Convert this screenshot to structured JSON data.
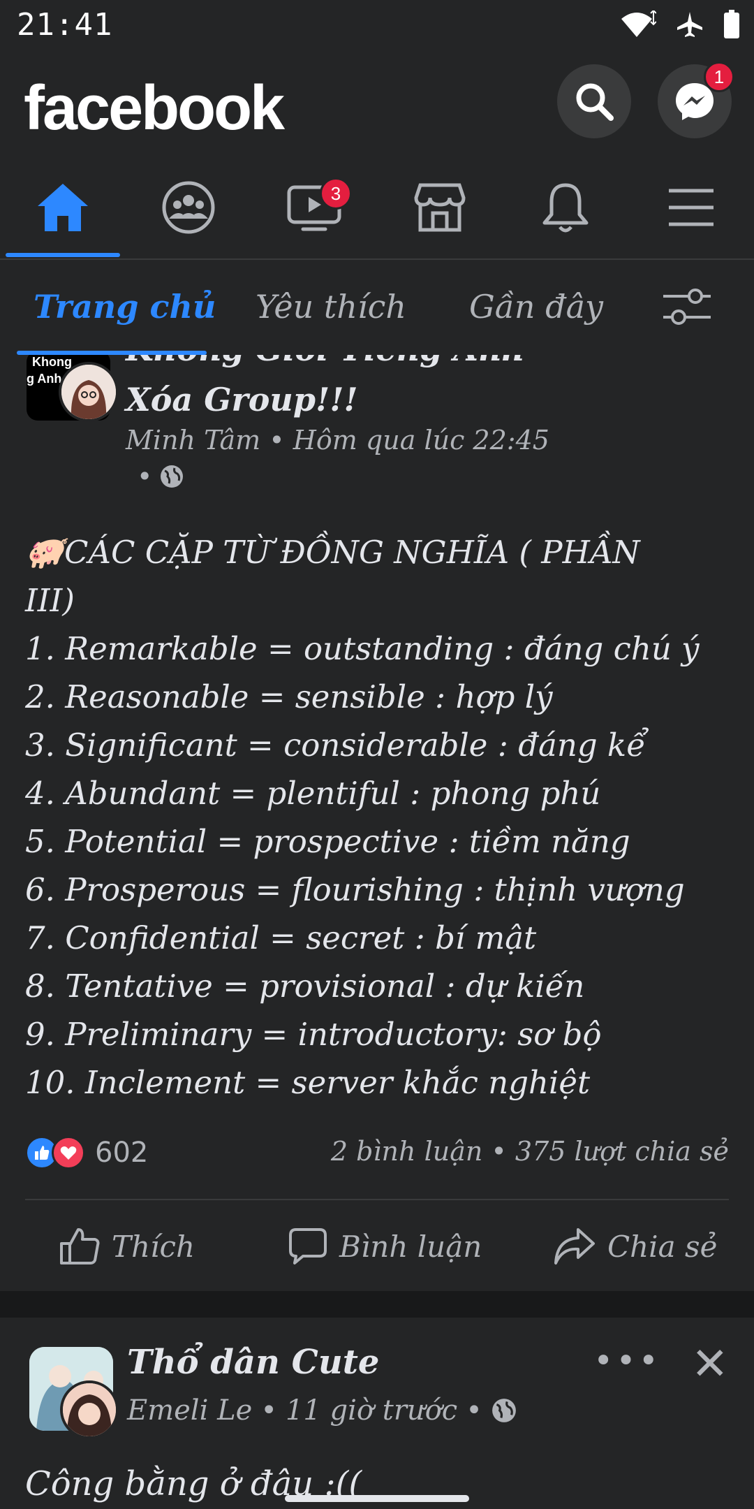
{
  "status_bar": {
    "time": "21:41"
  },
  "header": {
    "logo": "facebook",
    "messenger_badge": "1"
  },
  "nav": {
    "tabs": [
      {
        "name": "home",
        "icon": "home-icon",
        "active": true
      },
      {
        "name": "groups",
        "icon": "groups-icon"
      },
      {
        "name": "watch",
        "icon": "watch-icon",
        "badge": "3"
      },
      {
        "name": "marketplace",
        "icon": "marketplace-icon"
      },
      {
        "name": "notifications",
        "icon": "bell-icon"
      },
      {
        "name": "menu",
        "icon": "menu-icon"
      }
    ],
    "watch_badge": "3"
  },
  "feed_filter": {
    "tabs": [
      "Trang chủ",
      "Yêu thích",
      "Gần đây"
    ],
    "active_index": 0
  },
  "post": {
    "group_avatar_text": [
      "Khong",
      "g Anh"
    ],
    "group_title_line1": "Không Giỏi Tiếng Anh",
    "group_title_line2": "Xóa Group!!!",
    "author": "Minh Tâm",
    "time": "Hôm qua lúc 22:45",
    "body_lines": [
      "🐖CÁC CẶP TỪ ĐỒNG NGHĨA ( PHẦN",
      "III)",
      "1. Remarkable = outstanding : đáng chú ý",
      "2. Reasonable = sensible : hợp lý",
      "3. Significant = considerable : đáng kể",
      "4. Abundant = plentiful : phong phú",
      "5. Potential = prospective : tiềm năng",
      "6. Prosperous = flourishing : thịnh vượng",
      "7. Confidential = secret : bí mật",
      "8. Tentative = provisional : dự kiến",
      "9. Preliminary = introductory: sơ bộ",
      "10. Inclement = server khắc nghiệt"
    ],
    "reaction_count": "602",
    "stats": "2 bình luận • 375 lượt chia sẻ",
    "actions": {
      "like": "Thích",
      "comment": "Bình luận",
      "share": "Chia sẻ"
    }
  },
  "post2": {
    "title": "Thổ dân Cute",
    "author": "Emeli Le",
    "time": "11 giờ trước",
    "body": "Công bằng ở đâu :(("
  },
  "colors": {
    "accent": "#2d88ff",
    "badge": "#e41e3f",
    "surface": "#242526",
    "background": "#18191a"
  }
}
